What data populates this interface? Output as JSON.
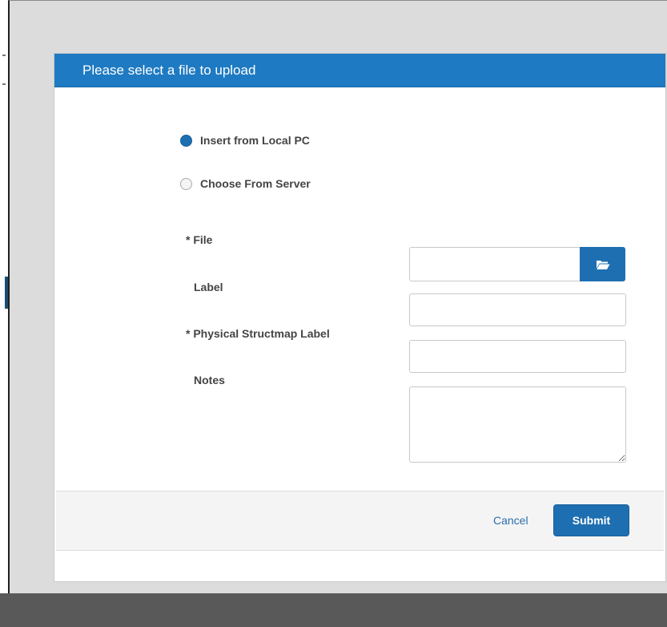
{
  "dialog": {
    "title": "Please select a file to upload"
  },
  "source_options": [
    {
      "label": "Insert from Local PC",
      "selected": true
    },
    {
      "label": "Choose From Server",
      "selected": false
    }
  ],
  "form": {
    "file": {
      "label": "* File",
      "value": "",
      "browse_icon": "folder-open-icon"
    },
    "label": {
      "label": "Label",
      "value": ""
    },
    "structmap": {
      "label": "* Physical Structmap Label",
      "value": ""
    },
    "notes": {
      "label": "Notes",
      "value": ""
    }
  },
  "footer": {
    "cancel_label": "Cancel",
    "submit_label": "Submit"
  },
  "colors": {
    "accent": "#1e7ac2",
    "button": "#1e6fb1",
    "overlay": "#dcdcdc"
  }
}
